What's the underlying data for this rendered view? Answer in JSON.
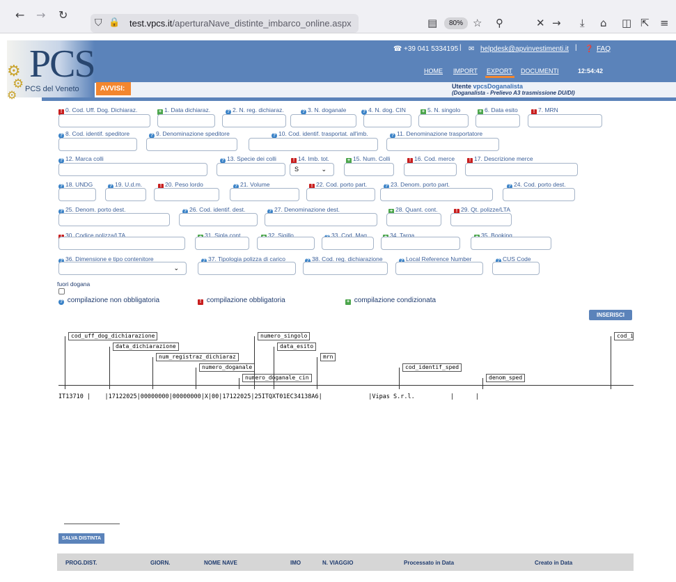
{
  "browser": {
    "url_domain": "test.vpcs.it",
    "url_path": "/aperturaNave_distinte_imbarco_online.aspx",
    "zoom": "80%"
  },
  "header": {
    "logo_text": "PCS",
    "logo_subtitle": "PCS del Veneto",
    "phone": "+39 041 5334195",
    "email": "helpdesk@apvinvestimenti.it",
    "faq": "FAQ",
    "nav": [
      "HOME",
      "IMPORT",
      "EXPORT",
      "DOCUMENTI"
    ],
    "active_nav": "EXPORT",
    "clock": "12:54:42",
    "avvisi": "AVVISI:",
    "user_prefix": "Utente",
    "user_name": "vpcsDoganalista",
    "user_role": "(Doganalista - Prelievo A3 trasmissione DU/DI)"
  },
  "fields": [
    {
      "id": "f0",
      "label": "0. Cod. Uff. Dog. Dichiaraz.",
      "req": "r"
    },
    {
      "id": "f1",
      "label": "1. Data dichiaraz.",
      "req": "g"
    },
    {
      "id": "f2",
      "label": "2. N. reg. dichiaraz.",
      "req": "q"
    },
    {
      "id": "f3",
      "label": "3. N. doganale",
      "req": "q"
    },
    {
      "id": "f4",
      "label": "4. N. dog. CIN",
      "req": "q"
    },
    {
      "id": "f5",
      "label": "5. N. singolo",
      "req": "g"
    },
    {
      "id": "f6",
      "label": "6. Data esito",
      "req": "g"
    },
    {
      "id": "f7",
      "label": "7. MRN",
      "req": "r"
    },
    {
      "id": "f8",
      "label": "8. Cod. identif. speditore",
      "req": "q"
    },
    {
      "id": "f9",
      "label": "9. Denominazione speditore",
      "req": "q"
    },
    {
      "id": "f10",
      "label": "10. Cod. identif. trasportat. all'imb.",
      "req": "q"
    },
    {
      "id": "f11",
      "label": "11. Denominazione trasportatore",
      "req": "q"
    },
    {
      "id": "f12",
      "label": "12. Marca colli",
      "req": "q"
    },
    {
      "id": "f13",
      "label": "13. Specie dei colli",
      "req": "q"
    },
    {
      "id": "f14",
      "label": "14. Imb. tot.",
      "req": "r",
      "value": "S"
    },
    {
      "id": "f15",
      "label": "15. Num. Colli",
      "req": "g"
    },
    {
      "id": "f16",
      "label": "16. Cod. merce",
      "req": "r"
    },
    {
      "id": "f17",
      "label": "17. Descrizione merce",
      "req": "r"
    },
    {
      "id": "f18",
      "label": "18. UNDG",
      "req": "q"
    },
    {
      "id": "f19",
      "label": "19. U.d.m.",
      "req": "q"
    },
    {
      "id": "f20",
      "label": "20. Peso lordo",
      "req": "r"
    },
    {
      "id": "f21",
      "label": "21. Volume",
      "req": "q"
    },
    {
      "id": "f22",
      "label": "22. Cod. porto part.",
      "req": "r"
    },
    {
      "id": "f23",
      "label": "23. Denom. porto part.",
      "req": "q"
    },
    {
      "id": "f24",
      "label": "24. Cod. porto dest.",
      "req": "q"
    },
    {
      "id": "f25",
      "label": "25. Denom. porto dest.",
      "req": "q"
    },
    {
      "id": "f26",
      "label": "26. Cod. identif. dest.",
      "req": "q"
    },
    {
      "id": "f27",
      "label": "27. Denominazione dest.",
      "req": "q"
    },
    {
      "id": "f28",
      "label": "28. Quant. cont.",
      "req": "g"
    },
    {
      "id": "f29",
      "label": "29. Qt. polizze/LTA",
      "req": "r"
    },
    {
      "id": "f30",
      "label": "30. Codice polizza/LTA",
      "req": "r"
    },
    {
      "id": "f31",
      "label": "31. Sigla cont.",
      "req": "g"
    },
    {
      "id": "f32",
      "label": "32. Sigillo",
      "req": "g"
    },
    {
      "id": "f33",
      "label": "33. Cod. Mag.",
      "req": "q"
    },
    {
      "id": "f34",
      "label": "34. Targa",
      "req": "g"
    },
    {
      "id": "f35",
      "label": "35. Booking",
      "req": "g"
    },
    {
      "id": "f36",
      "label": "36. Dimensione e tipo contenitore",
      "req": "q"
    },
    {
      "id": "f37",
      "label": "37. Tipologia polizza di carico",
      "req": "q"
    },
    {
      "id": "f38",
      "label": "38. Cod. reg. dichiarazione",
      "req": "q"
    },
    {
      "id": "flrn",
      "label": "Local Reference Number",
      "req": "q"
    },
    {
      "id": "fcus",
      "label": "CUS Code",
      "req": "q"
    }
  ],
  "fuori_dogana": "fuori dogana",
  "legend": {
    "optional": "compilazione non obbligatoria",
    "required": "compilazione obbligatoria",
    "conditional": "compilazione condizionata"
  },
  "colors": {
    "required": "#c81e1e",
    "conditional": "#4ca64c",
    "optional": "#3a82c7",
    "brand": "#5b83ba",
    "avvisi": "#f3862e"
  },
  "buttons": {
    "inserisci": "INSERISCI",
    "salva": "SALVA DISTINTA"
  },
  "record": {
    "tags": [
      "cod_uff_dog_dichiarazione",
      "data_dichiarazione",
      "num_registraz_dichiaraz",
      "numero_doganale",
      "numero_doganale_cin",
      "numero_singolo",
      "data_esito",
      "mrn",
      "cod_identif_sped",
      "denom_sped",
      "cod_i"
    ],
    "line": "IT13710 |    |17122025|00000000|00000000|X|00|17122025|25ITQXT01EC34138A6|             |Vipas S.r.l.          |      |"
  },
  "table_headers": [
    "PROG.DIST.",
    "GIORN.",
    "NOME NAVE",
    "IMO",
    "N. VIAGGIO",
    "Processato in Data",
    "Creato in Data"
  ]
}
